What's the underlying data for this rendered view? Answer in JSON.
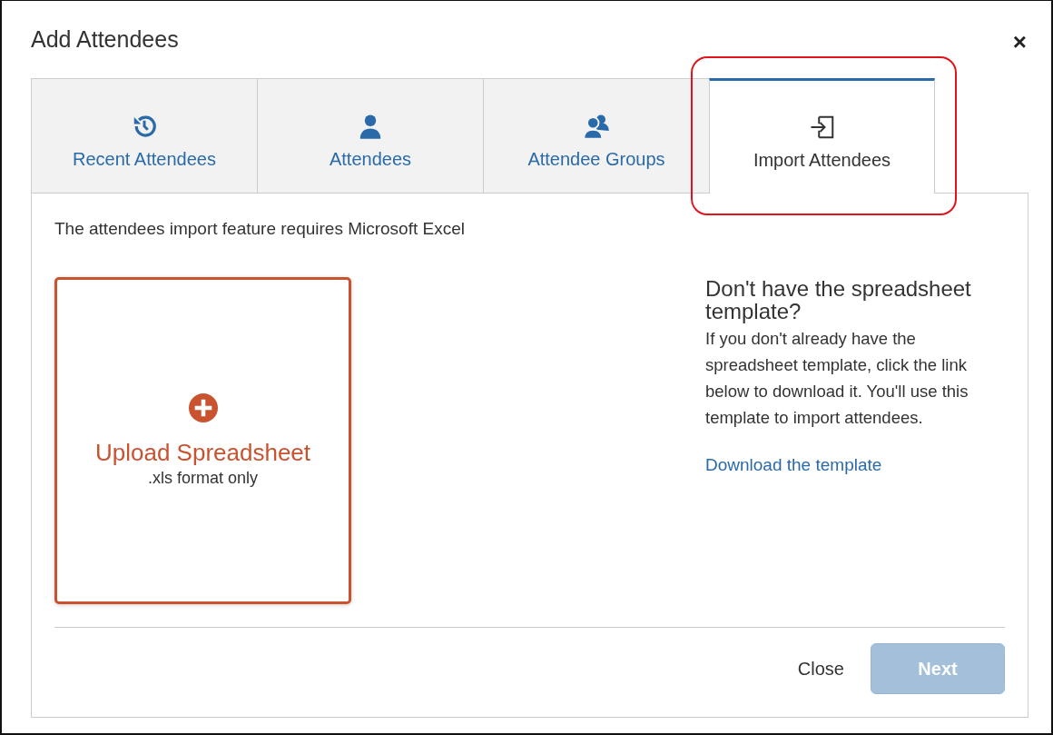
{
  "dialog": {
    "title": "Add Attendees",
    "close_icon": "×"
  },
  "tabs": [
    {
      "label": "Recent Attendees",
      "selected": false,
      "highlighted": false
    },
    {
      "label": "Attendees",
      "selected": false,
      "highlighted": false
    },
    {
      "label": "Attendee Groups",
      "selected": false,
      "highlighted": false
    },
    {
      "label": "Import Attendees",
      "selected": true,
      "highlighted": true
    }
  ],
  "notice": "The attendees import feature requires Microsoft Excel",
  "upload": {
    "title": "Upload Spreadsheet",
    "subtitle": ".xls format only"
  },
  "help": {
    "heading": "Don't have the spreadsheet template?",
    "text": "If you don't already have the spreadsheet template, click the link below to download it. You'll use this template to import attendees.",
    "link": "Download the template"
  },
  "footer": {
    "close": "Close",
    "next": {
      "label": "Next",
      "disabled": true
    }
  }
}
